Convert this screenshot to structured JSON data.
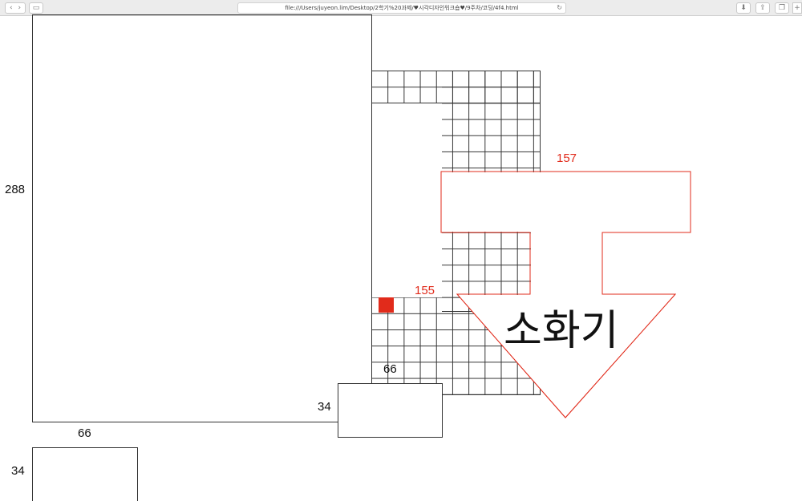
{
  "browser": {
    "url": "file:///Users/juyeon.lim/Desktop/2학기%20과제/♥시각디자인워크숍♥/9주차/코딩/4f4.html",
    "icons": [
      "back-icon",
      "forward-icon",
      "sidebar-icon",
      "reload-icon",
      "download-icon",
      "share-icon",
      "tabs-icon",
      "new-tab-icon"
    ]
  },
  "labels": {
    "left_height": "288",
    "bottom_width": "66",
    "bottom_height": "34",
    "small_width": "66",
    "small_height": "34",
    "arrow_width": "157",
    "grid_width": "155"
  },
  "arrow": {
    "text": "소화기",
    "color": "#e12b1b"
  },
  "colors": {
    "accent": "#e12b1b",
    "line": "#333333"
  }
}
